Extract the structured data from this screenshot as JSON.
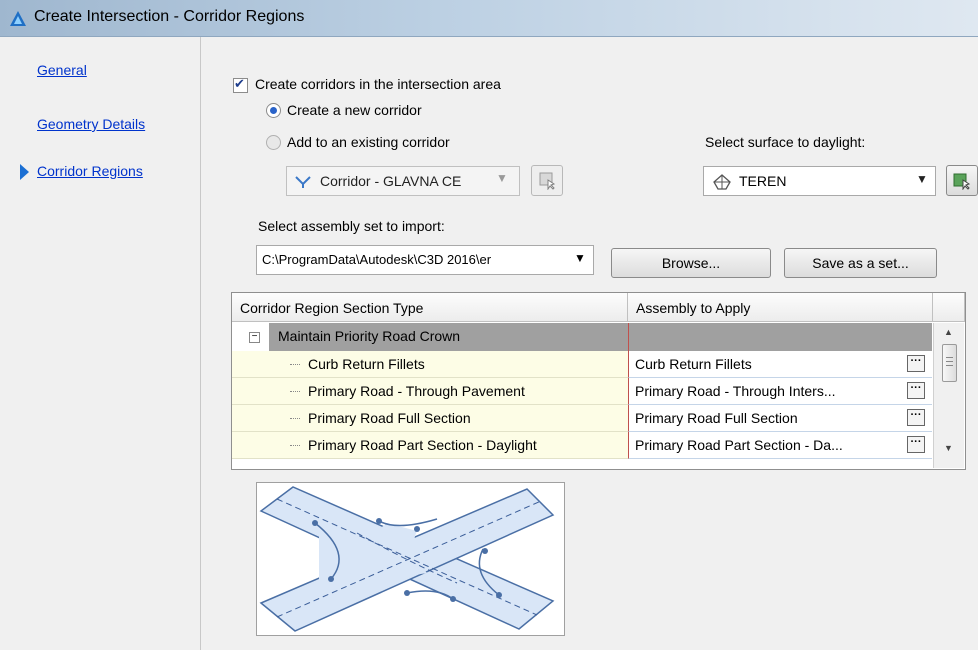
{
  "window": {
    "title": "Create Intersection - Corridor Regions"
  },
  "nav": {
    "items": [
      {
        "label": "General"
      },
      {
        "label": "Geometry Details"
      },
      {
        "label": "Corridor Regions"
      }
    ],
    "active_index": 2
  },
  "options": {
    "create_corridors_label": "Create corridors in the intersection area",
    "create_corridors_checked": true,
    "new_corridor_label": "Create a new corridor",
    "existing_corridor_label": "Add to an existing corridor",
    "selected_option": "new"
  },
  "corridor_combo": {
    "value": "Corridor - GLAVNA CE"
  },
  "surface": {
    "label": "Select surface to daylight:",
    "value": "TEREN"
  },
  "assembly_set": {
    "label": "Select assembly set to import:",
    "path": "C:\\ProgramData\\Autodesk\\C3D 2016\\er",
    "browse_label": "Browse...",
    "save_label": "Save as a set..."
  },
  "grid": {
    "columns": [
      "Corridor Region Section Type",
      "Assembly to Apply"
    ],
    "group": "Maintain Priority Road Crown",
    "rows": [
      {
        "type": "Curb Return Fillets",
        "assembly": "Curb Return Fillets"
      },
      {
        "type": "Primary Road - Through Pavement",
        "assembly": "Primary Road - Through Inters..."
      },
      {
        "type": "Primary Road Full Section",
        "assembly": "Primary Road Full Section"
      },
      {
        "type": "Primary Road Part Section - Daylight",
        "assembly": "Primary Road Part Section - Da..."
      }
    ]
  },
  "colors": {
    "accent": "#1b6fd3",
    "link": "#0033cc",
    "group_header": "#a0a0a0"
  }
}
